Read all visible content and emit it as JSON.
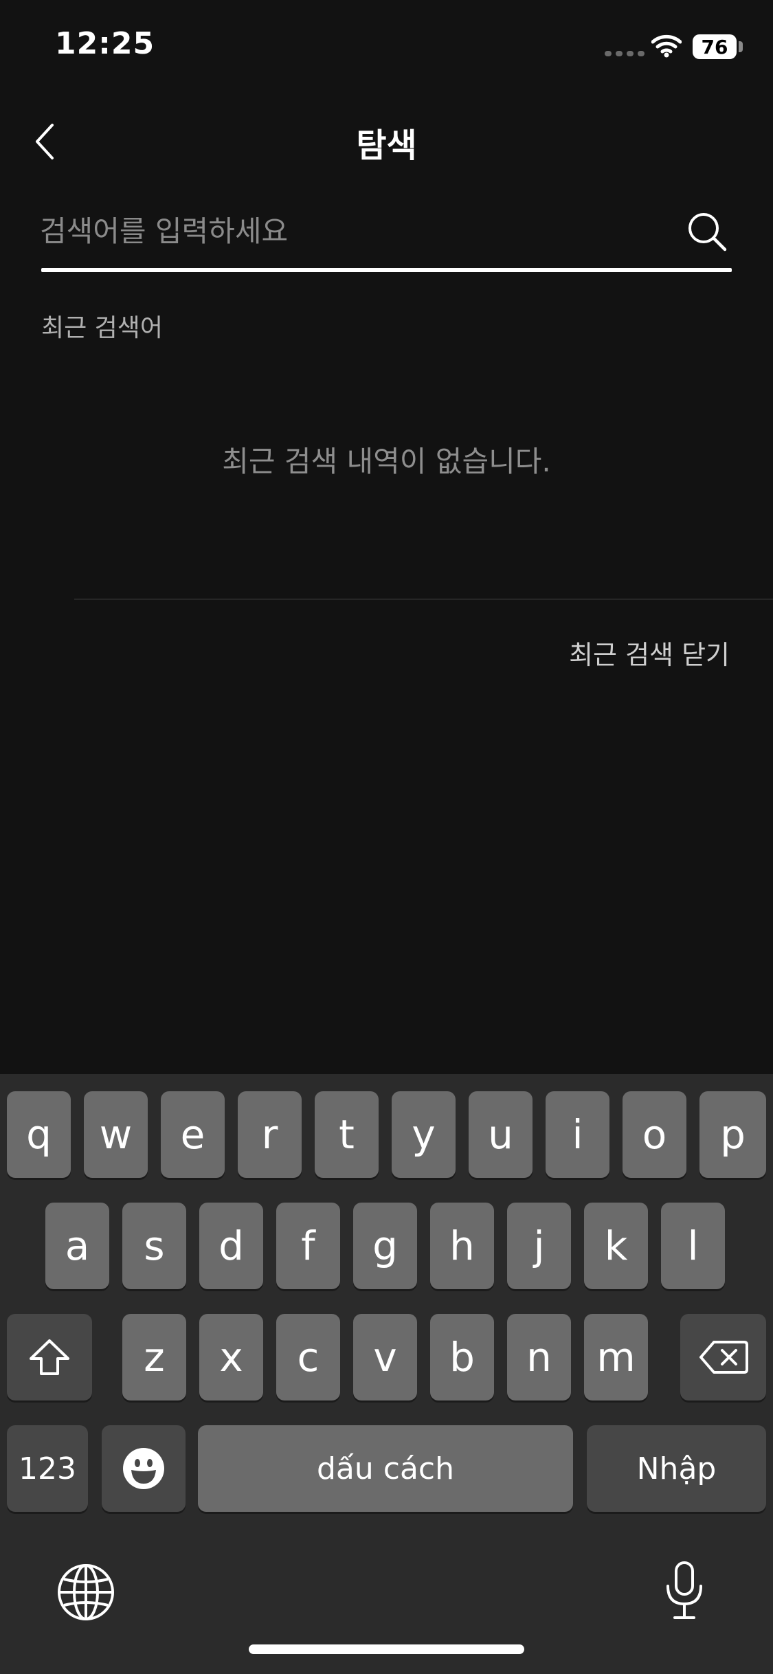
{
  "status_bar": {
    "time": "12:25",
    "battery": "76"
  },
  "header": {
    "title": "탐색"
  },
  "search": {
    "placeholder": "검색어를 입력하세요",
    "value": ""
  },
  "recent": {
    "label": "최근 검색어",
    "empty_message": "최근 검색 내역이 없습니다.",
    "close_label": "최근 검색 닫기"
  },
  "keyboard": {
    "row1": [
      "q",
      "w",
      "e",
      "r",
      "t",
      "y",
      "u",
      "i",
      "o",
      "p"
    ],
    "row2": [
      "a",
      "s",
      "d",
      "f",
      "g",
      "h",
      "j",
      "k",
      "l"
    ],
    "row3": [
      "z",
      "x",
      "c",
      "v",
      "b",
      "n",
      "m"
    ],
    "numbers_label": "123",
    "space_label": "dấu cách",
    "return_label": "Nhập"
  },
  "icons": {
    "back": "chevron-left-icon",
    "search": "search-icon",
    "wifi": "wifi-icon",
    "shift": "shift-icon",
    "delete": "backspace-icon",
    "emoji": "emoji-icon",
    "globe": "globe-icon",
    "microphone": "microphone-icon"
  }
}
